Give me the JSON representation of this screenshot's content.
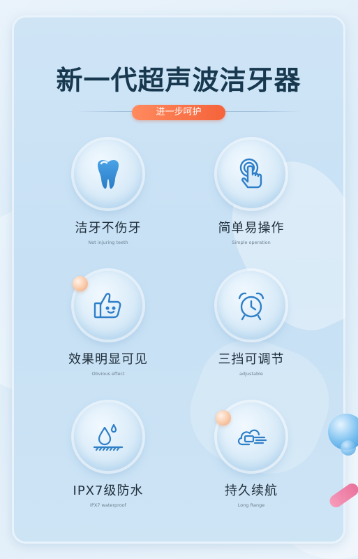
{
  "title": "新一代超声波洁牙器",
  "subtitle": "进一步呵护",
  "features": [
    {
      "label": "洁牙不伤牙",
      "sub": "Not injuring teeth",
      "icon": "tooth-icon"
    },
    {
      "label": "简单易操作",
      "sub": "Simple operation",
      "icon": "touch-finger-icon"
    },
    {
      "label": "效果明显可见",
      "sub": "Obvious effect",
      "icon": "thumbs-up-icon"
    },
    {
      "label": "三挡可调节",
      "sub": "adjustable",
      "icon": "alarm-clock-icon"
    },
    {
      "label": "IPX7级防水",
      "sub": "IPX7 waterproof",
      "icon": "water-drop-icon"
    },
    {
      "label": "持久续航",
      "sub": "Long Range",
      "icon": "battery-cloud-icon"
    }
  ],
  "colors": {
    "accent": "#f5633a",
    "title": "#17384f",
    "icon": "#2f7fc8"
  }
}
